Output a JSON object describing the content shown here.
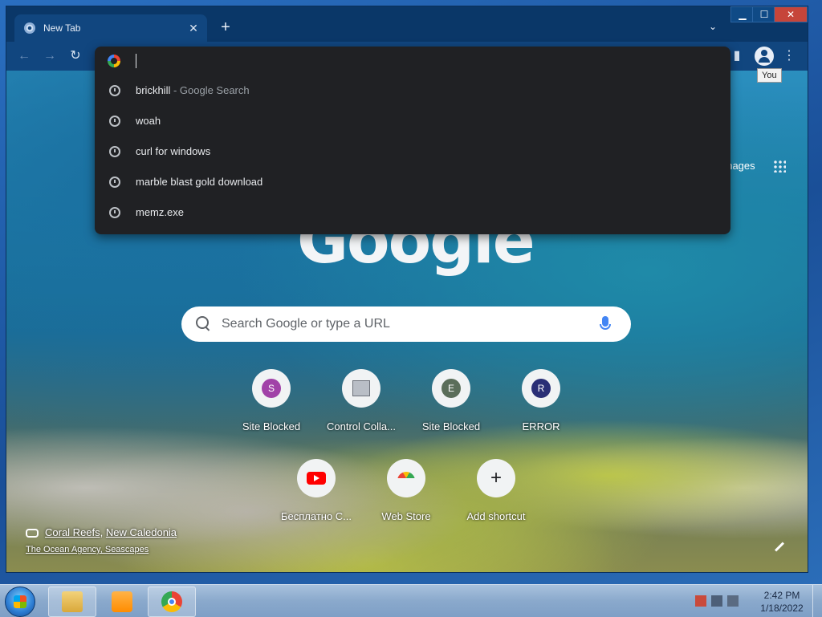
{
  "window": {
    "tab_title": "New Tab",
    "tab_close": "✕",
    "new_tab": "+",
    "tab_search": "⌄",
    "minimize": "▁",
    "maximize": "☐",
    "close": "✕"
  },
  "toolbar": {
    "back": "←",
    "forward": "→",
    "reload": "↻",
    "sidepanel": "▮",
    "menu": "⋮",
    "profile_tooltip": "You"
  },
  "omnibox": {
    "value": "",
    "suggestions": [
      {
        "text": "brickhill",
        "sub": " - Google Search"
      },
      {
        "text": "woah",
        "sub": ""
      },
      {
        "text": "curl for windows",
        "sub": ""
      },
      {
        "text": "marble blast gold download",
        "sub": ""
      },
      {
        "text": "memz.exe",
        "sub": ""
      }
    ]
  },
  "ntp": {
    "images_link": "Images",
    "logo": "Google",
    "search_placeholder": "Search Google or type a URL",
    "shortcuts": [
      {
        "label": "Site Blocked",
        "letter": "S",
        "color": "#a142a8"
      },
      {
        "label": "Control Colla...",
        "letter": "",
        "color": ""
      },
      {
        "label": "Site Blocked",
        "letter": "E",
        "color": "#5b6e5a"
      },
      {
        "label": "ERROR",
        "letter": "R",
        "color": "#2a2f76"
      },
      {
        "label": "Бесплатно С...",
        "letter": "",
        "color": "#ff0000"
      },
      {
        "label": "Web Store",
        "letter": "",
        "color": ""
      },
      {
        "label": "Add shortcut",
        "letter": "+",
        "color": ""
      }
    ],
    "attribution_place": "Coral Reefs",
    "attribution_sep": ", ",
    "attribution_country": "New Caledonia",
    "attribution_credit": "The Ocean Agency, Seascapes"
  },
  "taskbar": {
    "time": "2:42 PM",
    "date": "1/18/2022"
  }
}
